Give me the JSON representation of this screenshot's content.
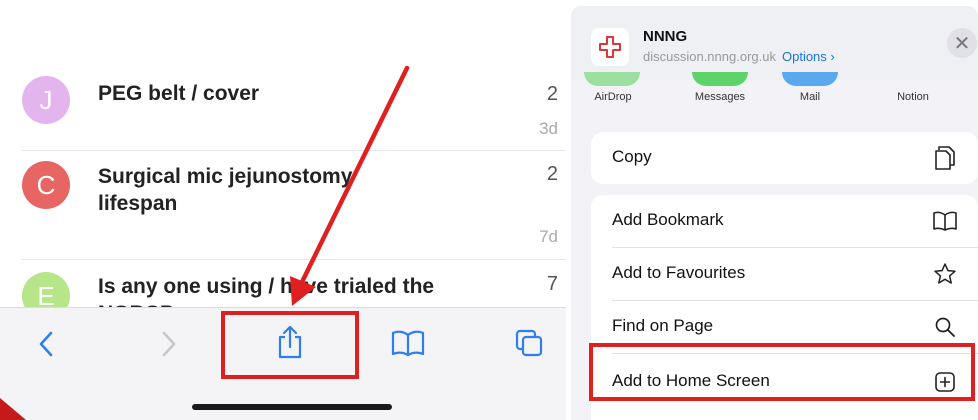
{
  "topics": [
    {
      "initial": "J",
      "color": "#e4b4ef",
      "title": "PEG belt / cover",
      "count": "2",
      "age": "3d"
    },
    {
      "initial": "C",
      "color": "#e76563",
      "title": "Surgical mic jejunostomy lifespan",
      "count": "2",
      "age": "7d"
    },
    {
      "initial": "E",
      "color": "#b6e58a",
      "title": "Is any one using / have trialed the NGBCP",
      "count": "7",
      "age": ""
    }
  ],
  "toolbar": {
    "back_icon": "chevron-left-icon",
    "forward_icon": "chevron-right-icon",
    "share_icon": "share-icon",
    "bookmarks_icon": "book-icon",
    "tabs_icon": "tabs-icon"
  },
  "share_sheet": {
    "site_name": "NNNG",
    "site_url": "discussion.nnng.org.uk",
    "options_label": "Options ›",
    "close_label": "✕",
    "apps": [
      {
        "label": "AirDrop",
        "color": "#9be0a0"
      },
      {
        "label": "Messages",
        "color": "#5dd36a"
      },
      {
        "label": "Mail",
        "color": "#5aa8f0"
      },
      {
        "label": "Notion",
        "color": "#ffffff"
      }
    ],
    "actions": {
      "copy": "Copy",
      "add_bookmark": "Add Bookmark",
      "add_to_favourites": "Add to Favourites",
      "find_on_page": "Find on Page",
      "add_to_home_screen": "Add to Home Screen"
    }
  },
  "colors": {
    "highlight": "#e02020",
    "arrow": "#e02020",
    "link_blue": "#1a73e8",
    "toolbar_blue": "#2f7ef0",
    "toolbar_disabled": "#c7c7cc"
  }
}
